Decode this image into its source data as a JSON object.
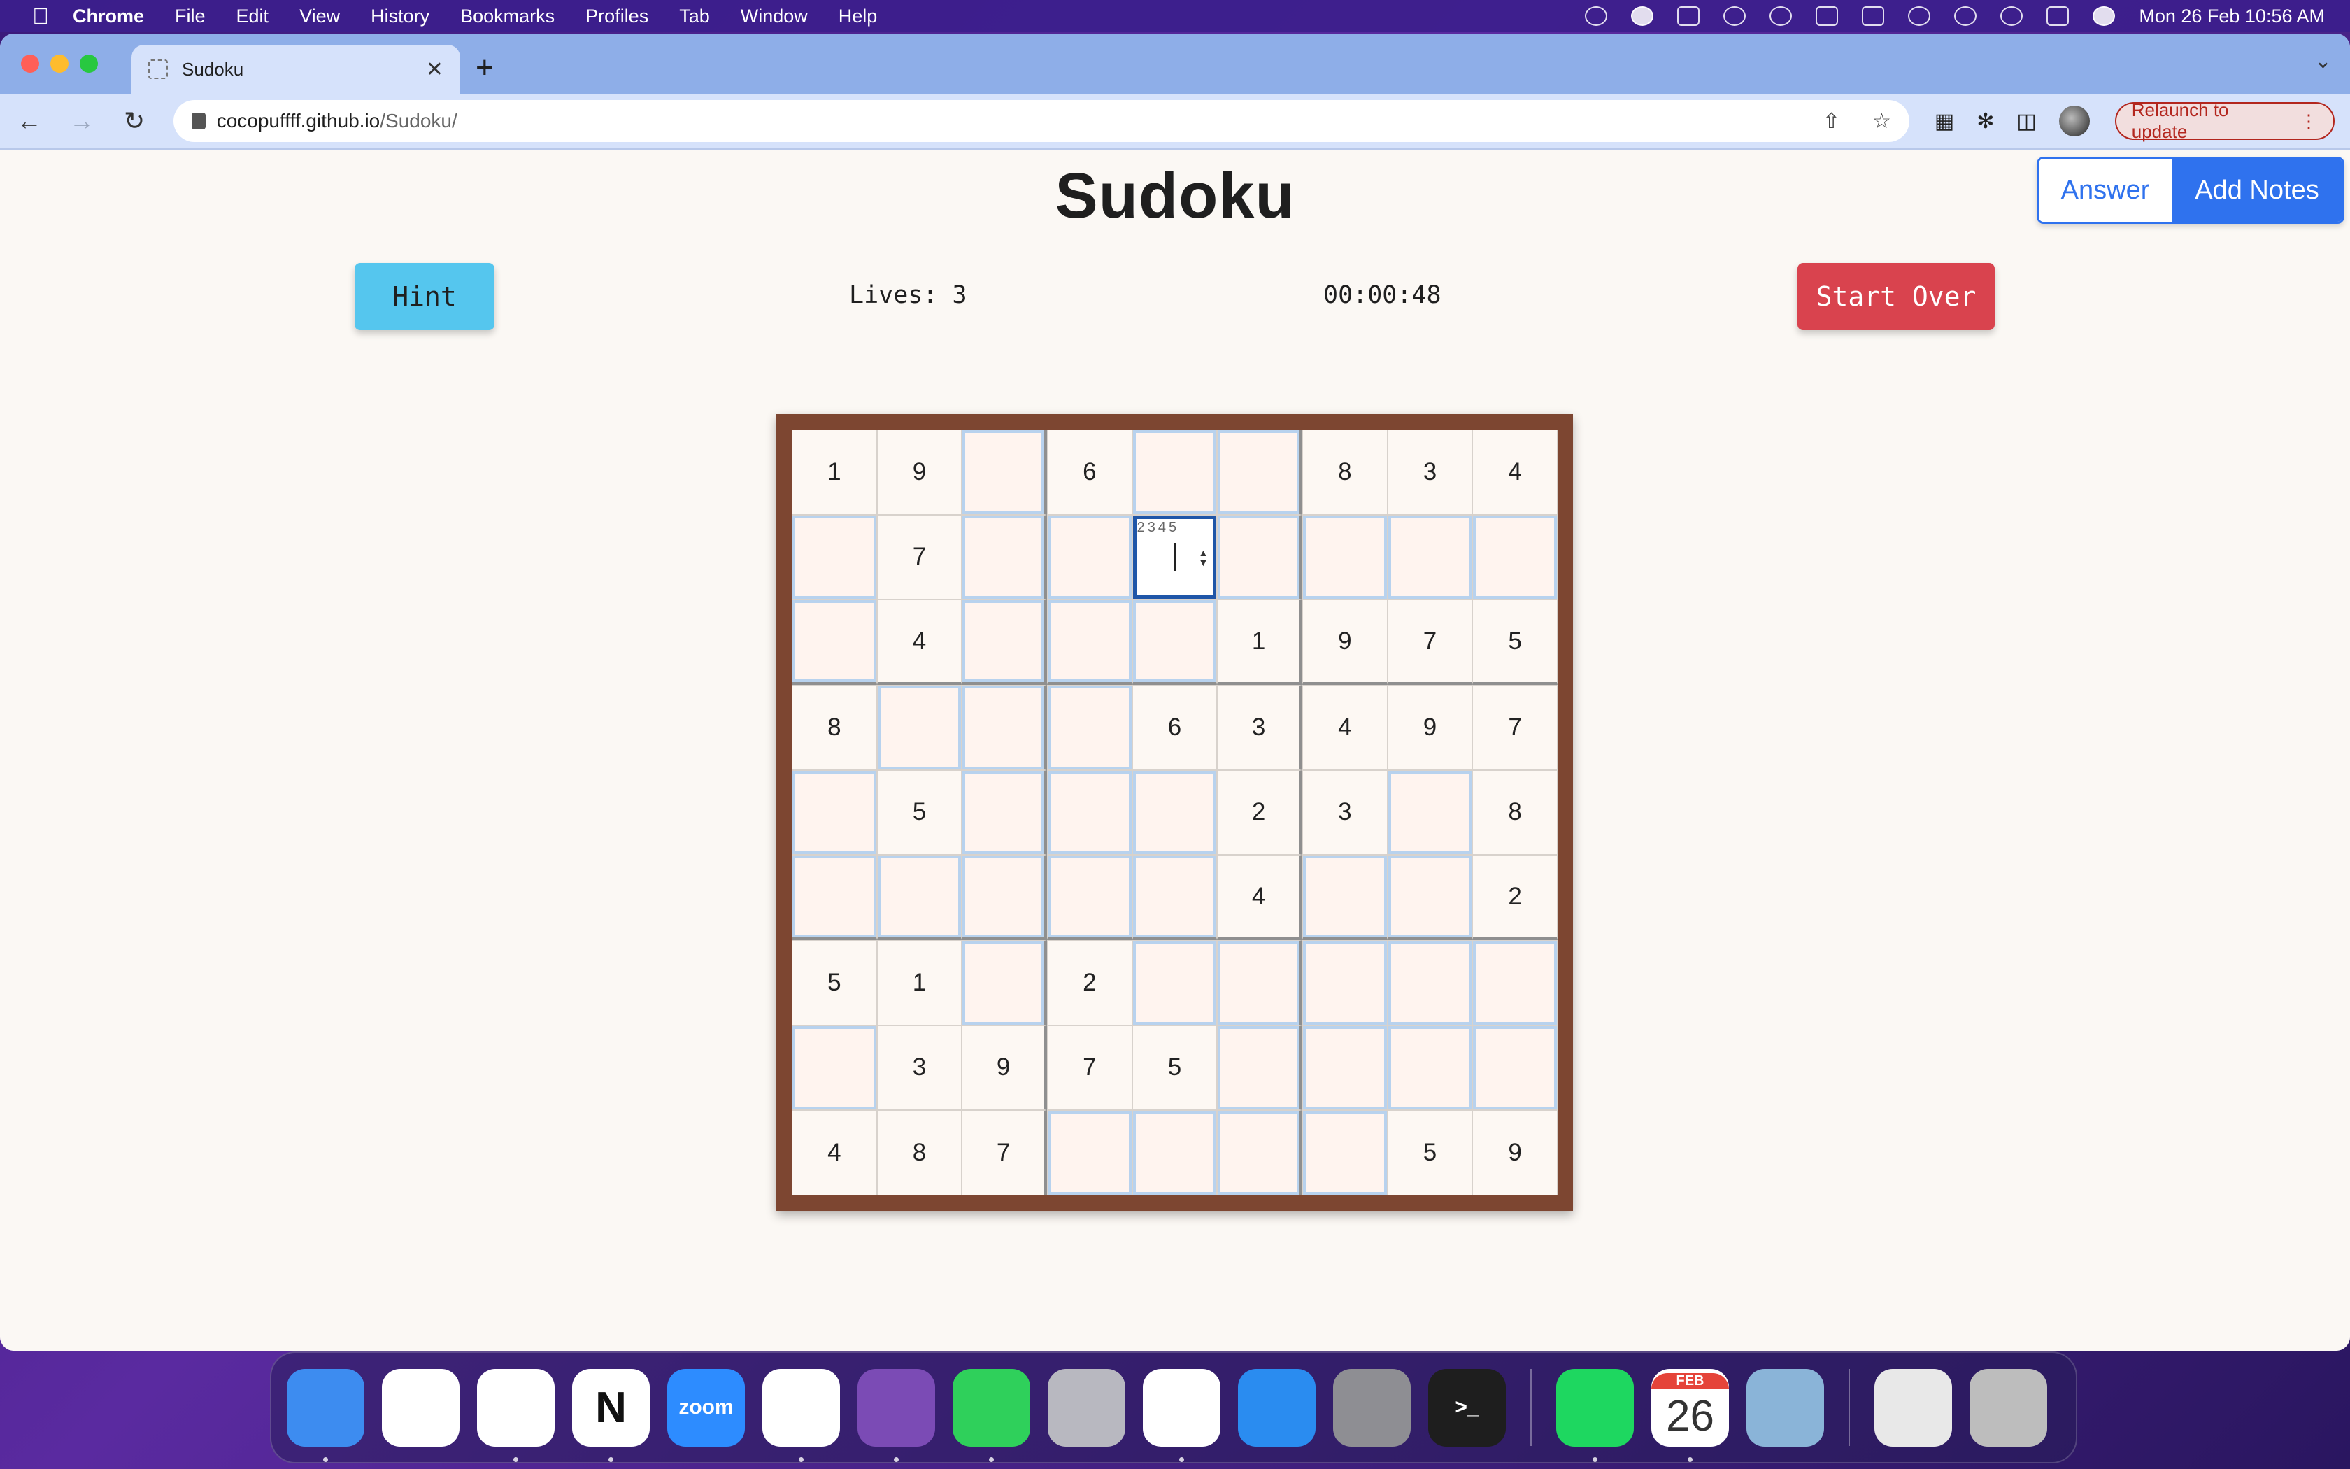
{
  "menubar": {
    "app": "Chrome",
    "items": [
      "File",
      "Edit",
      "View",
      "History",
      "Bookmarks",
      "Profiles",
      "Tab",
      "Window",
      "Help"
    ],
    "datetime": "Mon 26 Feb  10:56 AM"
  },
  "browser": {
    "tab_title": "Sudoku",
    "url_host": "cocopuffff.github.io",
    "url_path": "/Sudoku/",
    "relaunch_label": "Relaunch to update"
  },
  "page": {
    "title": "Sudoku",
    "mode_answer": "Answer",
    "mode_notes": "Add Notes",
    "hint": "Hint",
    "lives": "Lives: 3",
    "timer": "00:00:48",
    "start_over": "Start Over"
  },
  "board": {
    "rows": [
      [
        "1",
        "9",
        "",
        "6",
        "",
        "",
        "8",
        "3",
        "4"
      ],
      [
        "",
        "7",
        "",
        "",
        "",
        "",
        "",
        "",
        ""
      ],
      [
        "",
        "4",
        "",
        "",
        "",
        "1",
        "9",
        "7",
        "5"
      ],
      [
        "8",
        "",
        "",
        "",
        "6",
        "3",
        "4",
        "9",
        "7"
      ],
      [
        "",
        "5",
        "",
        "",
        "",
        "2",
        "3",
        "",
        "8"
      ],
      [
        "",
        "",
        "",
        "",
        "",
        "4",
        "",
        "",
        "2"
      ],
      [
        "5",
        "1",
        "",
        "2",
        "",
        "",
        "",
        "",
        ""
      ],
      [
        "",
        "3",
        "9",
        "7",
        "5",
        "",
        "",
        "",
        ""
      ],
      [
        "4",
        "8",
        "7",
        "",
        "",
        "",
        "",
        "5",
        "9"
      ]
    ],
    "selected": {
      "row": 1,
      "col": 4,
      "notes": "2345"
    }
  },
  "dock": {
    "apps": [
      {
        "name": "finder",
        "label": "",
        "color": "#3d8cf0",
        "dot": true
      },
      {
        "name": "onedrive",
        "label": "",
        "color": "#ffffff",
        "dot": false
      },
      {
        "name": "slack",
        "label": "",
        "color": "#ffffff",
        "dot": true
      },
      {
        "name": "notion",
        "label": "N",
        "color": "#ffffff",
        "dot": true
      },
      {
        "name": "zoom",
        "label": "zoom",
        "color": "#2d8cff",
        "dot": false
      },
      {
        "name": "vscode",
        "label": "",
        "color": "#ffffff",
        "dot": true
      },
      {
        "name": "github-desktop",
        "label": "",
        "color": "#7b4bb5",
        "dot": true
      },
      {
        "name": "whatsapp",
        "label": "",
        "color": "#2fd05b",
        "dot": true
      },
      {
        "name": "launchpad",
        "label": "",
        "color": "#b8b8c0",
        "dot": false
      },
      {
        "name": "chrome",
        "label": "",
        "color": "#ffffff",
        "dot": true
      },
      {
        "name": "app-store",
        "label": "",
        "color": "#2a8cf0",
        "dot": false
      },
      {
        "name": "system-settings",
        "label": "",
        "color": "#8e8e93",
        "dot": false
      },
      {
        "name": "terminal",
        "label": ">_",
        "color": "#1e1e1e",
        "dot": false
      }
    ],
    "recent_apps": [
      {
        "name": "spotify",
        "label": "",
        "color": "#1ed760",
        "dot": true
      },
      {
        "name": "calendar",
        "label": "",
        "color": "#ffffff",
        "dot": true,
        "month": "FEB",
        "day": "26"
      },
      {
        "name": "preview",
        "label": "",
        "color": "#8ab4d8",
        "dot": false
      }
    ],
    "folders": [
      {
        "name": "documents-stack",
        "label": "",
        "color": "#e8e8e8",
        "dot": false
      },
      {
        "name": "trash",
        "label": "",
        "color": "#bdbdbd",
        "dot": false
      }
    ]
  }
}
